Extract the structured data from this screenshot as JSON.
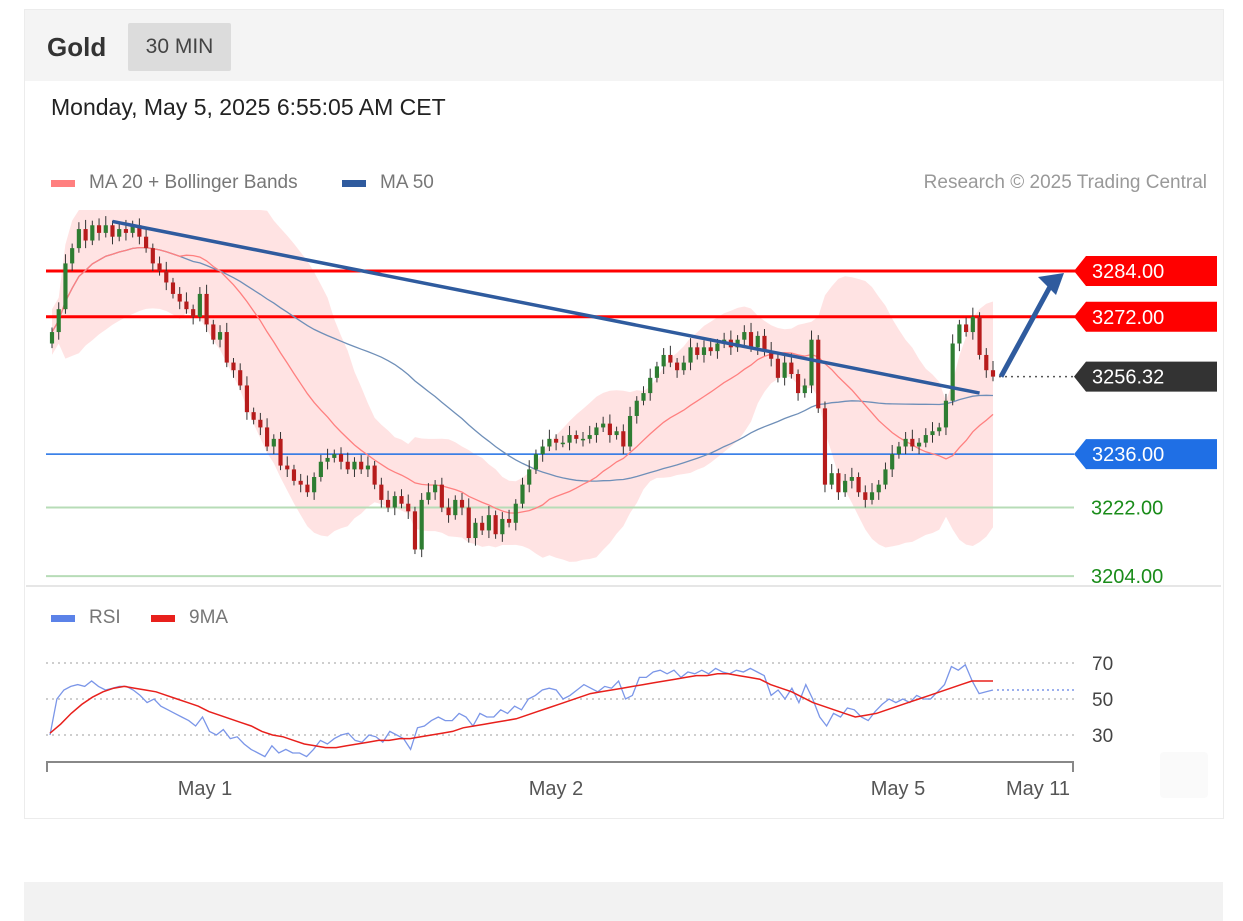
{
  "header": {
    "instrument": "Gold",
    "timeframe": "30 MIN"
  },
  "timestamp": "Monday, May 5, 2025 6:55:05 AM CET",
  "legend": {
    "ma20": {
      "label": "MA 20 + Bollinger Bands",
      "color": "#ff7f7f"
    },
    "ma50": {
      "label": "MA 50",
      "color": "#2f5b9e"
    }
  },
  "credit": "Research © 2025 Trading Central",
  "rsi_legend": {
    "rsi": {
      "label": "RSI",
      "color": "#5b82e8"
    },
    "ma9": {
      "label": "9MA",
      "color": "#e8201c"
    }
  },
  "chart_data": [
    {
      "type": "candlestick",
      "title": "Gold",
      "timeframe": "30 MIN",
      "ylim": [
        3203,
        3300
      ],
      "x_ticks": [
        "May 1",
        "May 2",
        "May 5",
        "May 11"
      ],
      "levels": [
        {
          "value": 3284.0,
          "label": "3284.00",
          "kind": "resistance",
          "color": "#ff0000"
        },
        {
          "value": 3272.0,
          "label": "3272.00",
          "kind": "resistance",
          "color": "#ff0000"
        },
        {
          "value": 3256.32,
          "label": "3256.32",
          "kind": "last",
          "color": "#333333"
        },
        {
          "value": 3236.0,
          "label": "3236.00",
          "kind": "pivot",
          "color": "#1f6fe5"
        },
        {
          "value": 3222.0,
          "label": "3222.00",
          "kind": "support",
          "color": "#1a8c1a"
        },
        {
          "value": 3204.0,
          "label": "3204.00",
          "kind": "support",
          "color": "#1a8c1a"
        }
      ],
      "closes": [
        3268,
        3274,
        3286,
        3290,
        3295,
        3292,
        3296,
        3294,
        3296,
        3293,
        3295,
        3294,
        3296,
        3293,
        3290,
        3286,
        3284,
        3281,
        3278,
        3276,
        3274,
        3272,
        3278,
        3270,
        3266,
        3268,
        3260,
        3258,
        3254,
        3247,
        3245,
        3243,
        3238,
        3240,
        3233,
        3232,
        3229,
        3228,
        3226,
        3230,
        3234,
        3235,
        3236,
        3234,
        3232,
        3234,
        3232,
        3233,
        3228,
        3224,
        3222,
        3225,
        3223,
        3221,
        3211,
        3224,
        3226,
        3228,
        3222,
        3220,
        3224,
        3222,
        3214,
        3218,
        3216,
        3220,
        3215,
        3219,
        3218,
        3223,
        3228,
        3232,
        3236,
        3238,
        3240,
        3239,
        3239,
        3241,
        3240,
        3240,
        3241,
        3243,
        3244,
        3241,
        3242,
        3238,
        3246,
        3250,
        3252,
        3256,
        3259,
        3262,
        3260,
        3258,
        3260,
        3264,
        3262,
        3264,
        3263,
        3265,
        3266,
        3264,
        3266,
        3268,
        3264,
        3267,
        3263,
        3261,
        3256,
        3260,
        3257,
        3252,
        3254,
        3266,
        3248,
        3228,
        3231,
        3226,
        3229,
        3230,
        3226,
        3224,
        3226,
        3228,
        3232,
        3236,
        3238,
        3240,
        3238,
        3239,
        3241,
        3242,
        3243,
        3250,
        3265,
        3270,
        3268,
        3272,
        3262,
        3258,
        3256.32
      ],
      "rsi": [
        30,
        50,
        55,
        57,
        58,
        57,
        60,
        57,
        55,
        56,
        57,
        57,
        55,
        52,
        48,
        50,
        46,
        44,
        42,
        40,
        38,
        35,
        40,
        32,
        30,
        33,
        28,
        29,
        25,
        22,
        20,
        18,
        24,
        20,
        22,
        20,
        20,
        18,
        22,
        27,
        25,
        28,
        30,
        31,
        27,
        26,
        30,
        29,
        26,
        32,
        30,
        28,
        22,
        34,
        35,
        38,
        40,
        38,
        38,
        42,
        40,
        35,
        42,
        40,
        40,
        44,
        42,
        46,
        44,
        50,
        52,
        55,
        56,
        55,
        50,
        52,
        55,
        58,
        56,
        54,
        57,
        56,
        60,
        50,
        52,
        62,
        62,
        65,
        66,
        64,
        66,
        62,
        65,
        64,
        66,
        64,
        67,
        65,
        64,
        66,
        65,
        67,
        65,
        63,
        52,
        55,
        50,
        56,
        48,
        58,
        50,
        40,
        35,
        42,
        40,
        45,
        44,
        40,
        38,
        43,
        47,
        50,
        48,
        50,
        48,
        52,
        50,
        50,
        54,
        58,
        68,
        66,
        69,
        60,
        53,
        54,
        55
      ],
      "rsi_ma9": [
        31,
        36,
        42,
        47,
        51,
        54,
        56,
        57,
        56,
        55,
        54,
        52,
        50,
        48,
        46,
        43,
        41,
        39,
        37,
        35,
        32,
        30,
        29,
        27,
        25,
        24,
        23,
        23,
        24,
        25,
        26,
        27,
        27,
        28,
        28,
        29,
        30,
        31,
        32,
        34,
        35,
        36,
        37,
        38,
        39,
        41,
        43,
        45,
        47,
        49,
        51,
        53,
        54,
        55,
        56,
        57,
        58,
        59,
        60,
        61,
        62,
        63,
        63,
        64,
        64,
        63,
        62,
        61,
        58,
        56,
        54,
        51,
        48,
        46,
        44,
        42,
        40,
        41,
        42,
        44,
        46,
        48,
        50,
        52,
        54,
        56,
        58,
        60,
        60,
        60
      ],
      "rsi_levels": [
        70,
        50,
        30
      ],
      "rsi_projection": 55
    }
  ]
}
